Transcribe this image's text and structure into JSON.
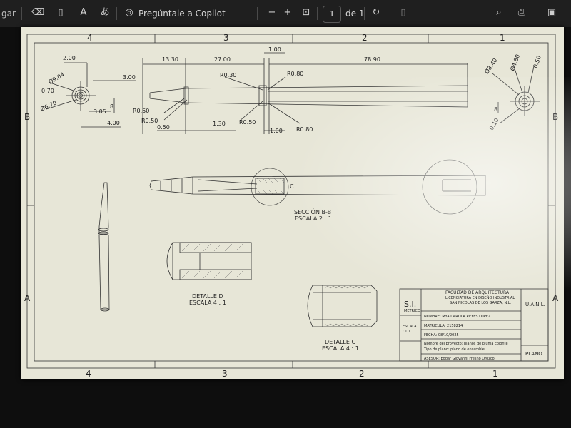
{
  "toolbar": {
    "left_fragment": "gar",
    "copilot_label": "Pregúntale a Copilot",
    "page_current": "1",
    "page_of": "de 1"
  },
  "drawing": {
    "zones_top": [
      "4",
      "3",
      "2",
      "1"
    ],
    "zones_bottom": [
      "4",
      "3",
      "2",
      "1"
    ],
    "rows": [
      "B",
      "A"
    ],
    "dims": {
      "d200": "2.00",
      "d300": "3.00",
      "d904": "Ø9.04",
      "d070": "0.70",
      "d670": "Ø6.70",
      "d305": "3.05",
      "d400": "4.00",
      "d8a": "8",
      "d1330": "13.30",
      "d2700": "27.00",
      "d100a": "1.00",
      "d7890": "78.90",
      "r030": "R0.30",
      "r080a": "R0.80",
      "r050a": "R0.50",
      "r050b": "R0.50",
      "d050": "0.50",
      "d130": "1.30",
      "r050c": "R0.50",
      "d100b": "1.00",
      "r080b": "R0.80",
      "d840": "Ø8.40",
      "d480": "Ø4.80",
      "d050b": "0.50",
      "r010": "0.10",
      "d8b": "8"
    },
    "section_label": "C",
    "section_title": "SECCIÓN B-B",
    "section_scale": "ESCALA 2 : 1",
    "detail_d_title": "DETALLE D",
    "detail_d_scale": "ESCALA 4 : 1",
    "detail_c_title": "DETALLE C",
    "detail_c_scale": "ESCALA 4 : 1"
  },
  "title_block": {
    "si": "S.I.",
    "metrico": "METRICO",
    "faculty": "FACULTAD DE ARQUITECTURA",
    "program": "LICENCIATURA EN DISEÑO INDUSTRIAL",
    "location": "SAN NICOLAS DE LOS GARZA, N.L.",
    "uanl": "U.A.N.L.",
    "nombre": "NOMBRE: MYA CAROLA REYES LOPEZ",
    "matricula": "MATRICULA: 2158214",
    "escala": "ESCALA",
    "escala_val": ": 1:1",
    "fecha": "FECHA: 08/10/2025",
    "proyecto": "Nombre del proyecto: planos de pluma cojonte",
    "tipo": "Tipo de plano: plano de ensamble",
    "asesor": "ASESOR: Edgar Giovanni Fresño Orozco",
    "plano": "PLANO"
  }
}
